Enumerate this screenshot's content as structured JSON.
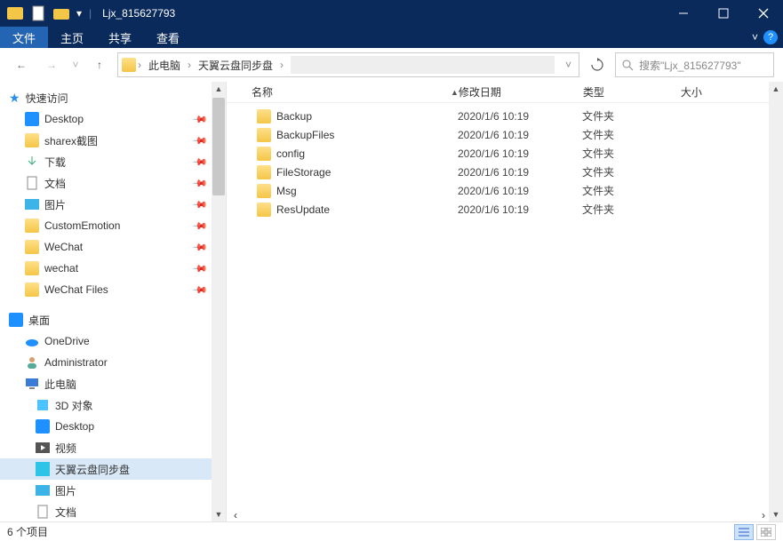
{
  "title": "Ljx_815627793",
  "ribbon": {
    "file": "文件",
    "home": "主页",
    "share": "共享",
    "view": "查看"
  },
  "breadcrumbs": [
    "此电脑",
    "天翼云盘同步盘"
  ],
  "search_placeholder": "搜索\"Ljx_815627793\"",
  "columns": {
    "name": "名称",
    "date": "修改日期",
    "type": "类型",
    "size": "大小"
  },
  "rows": [
    {
      "name": "Backup",
      "date": "2020/1/6 10:19",
      "type": "文件夹"
    },
    {
      "name": "BackupFiles",
      "date": "2020/1/6 10:19",
      "type": "文件夹"
    },
    {
      "name": "config",
      "date": "2020/1/6 10:19",
      "type": "文件夹"
    },
    {
      "name": "FileStorage",
      "date": "2020/1/6 10:19",
      "type": "文件夹"
    },
    {
      "name": "Msg",
      "date": "2020/1/6 10:19",
      "type": "文件夹"
    },
    {
      "name": "ResUpdate",
      "date": "2020/1/6 10:19",
      "type": "文件夹"
    }
  ],
  "tree": {
    "quick": "快速访问",
    "quick_items": [
      "Desktop",
      "sharex截图",
      "下载",
      "文档",
      "图片",
      "CustomEmotion",
      "WeChat",
      "wechat",
      "WeChat Files"
    ],
    "desktop": "桌面",
    "desktop_items": [
      "OneDrive",
      "Administrator",
      "此电脑"
    ],
    "pc_items": [
      "3D 对象",
      "Desktop",
      "视频",
      "天翼云盘同步盘",
      "图片",
      "文档"
    ]
  },
  "status": "6 个项目"
}
